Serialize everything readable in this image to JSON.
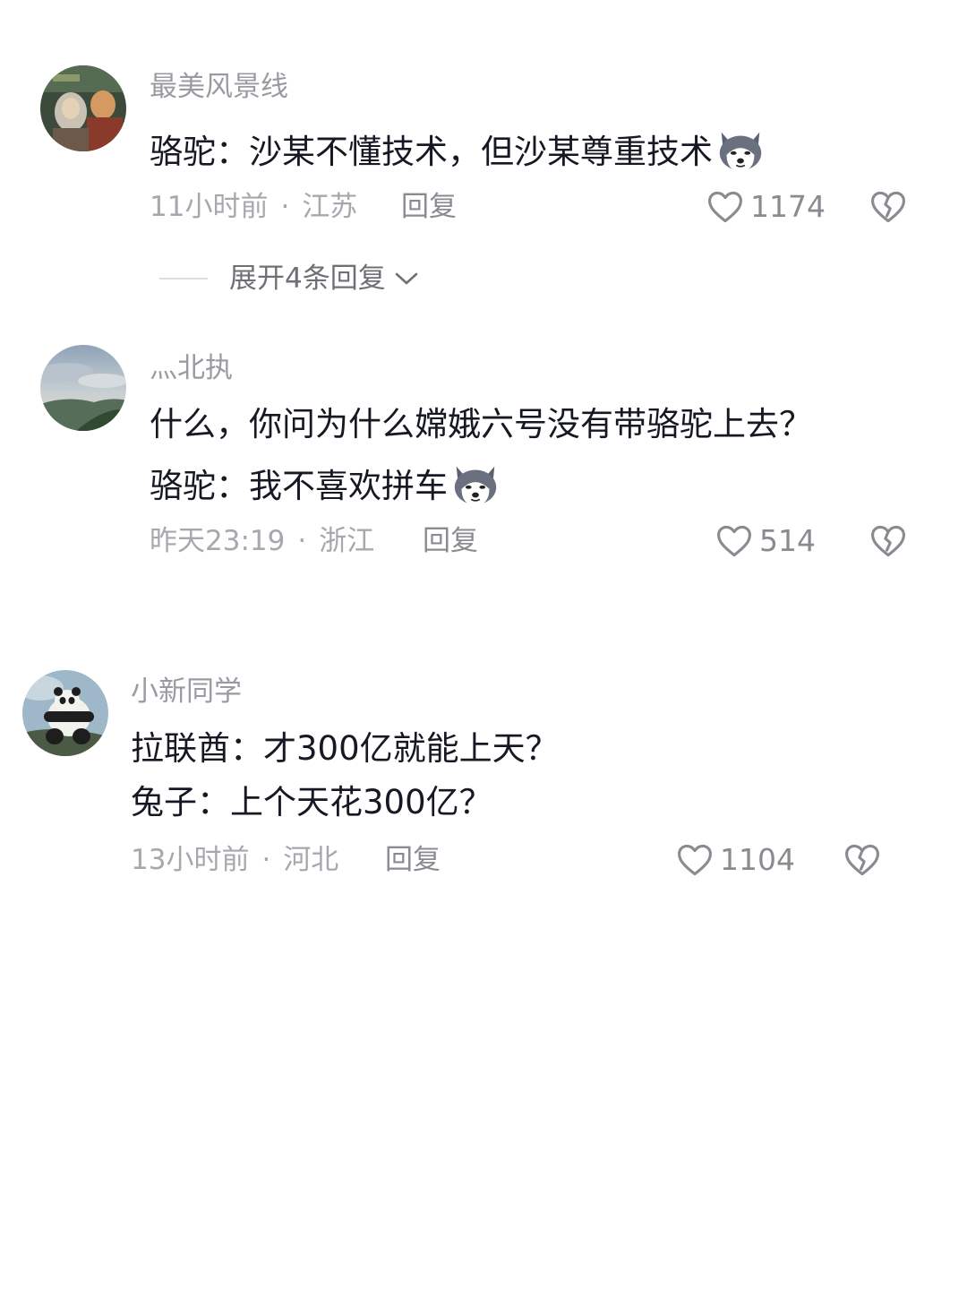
{
  "comments": [
    {
      "username": "最美风景线",
      "lines": [
        "骆驼：沙某不懂技术，但沙某尊重技术"
      ],
      "emoji_icon": "husky-dog-emoji-icon",
      "time": "11小时前",
      "location": "江苏",
      "reply_label": "回复",
      "likes": "1174",
      "expand_label": "展开4条回复"
    },
    {
      "username": "灬北执",
      "lines": [
        "什么，你问为什么嫦娥六号没有带骆驼上去？",
        "骆驼：我不喜欢拼车"
      ],
      "emoji_icon": "husky-dog-emoji-icon",
      "time": "昨天23:19",
      "location": "浙江",
      "reply_label": "回复",
      "likes": "514"
    },
    {
      "username": "小新同学",
      "lines": [
        "拉联酋：才300亿就能上天？",
        "兔子：上个天花300亿？"
      ],
      "time": "13小时前",
      "location": "河北",
      "reply_label": "回复",
      "likes": "1104"
    }
  ],
  "separator": "·",
  "icons": {
    "like": "heart-outline-icon",
    "dislike": "broken-heart-icon",
    "expand": "chevron-down-icon"
  },
  "colors": {
    "text_primary": "#161823",
    "text_secondary": "#9a9ba1",
    "icon_gray": "#8a8b91"
  }
}
